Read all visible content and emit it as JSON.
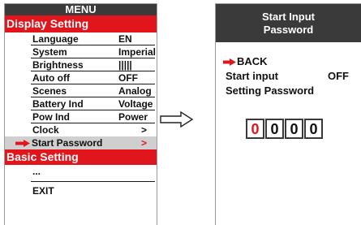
{
  "menu": {
    "title": "MENU",
    "section_display": "Display Setting",
    "rows": [
      {
        "label": "Language",
        "value": "EN"
      },
      {
        "label": "System",
        "value": "Imperial"
      },
      {
        "label": "Brightness",
        "value": "|||||"
      },
      {
        "label": "Auto off",
        "value": "OFF"
      },
      {
        "label": "Scenes",
        "value": "Analog"
      },
      {
        "label": "Battery Ind",
        "value": "Voltage"
      },
      {
        "label": "Pow Ind",
        "value": "Power"
      },
      {
        "label": "Clock",
        "value": ">"
      },
      {
        "label": "Start Password",
        "value": ">"
      }
    ],
    "section_basic": "Basic Setting",
    "ellipsis": "...",
    "exit": "EXIT"
  },
  "panel": {
    "title_line1": "Start Input",
    "title_line2": "Password",
    "back": "BACK",
    "start_input_label": "Start input",
    "start_input_value": "OFF",
    "setting_password": "Setting Password",
    "digits": [
      "0",
      "0",
      "0",
      "0"
    ]
  },
  "colors": {
    "accent_red": "#e0161c",
    "header_dark": "#3a3a3a",
    "selection_gray": "#cfcfcf"
  },
  "icons": {
    "pointer": "right-arrow-icon",
    "transition": "double-outline-right-arrow-icon"
  }
}
